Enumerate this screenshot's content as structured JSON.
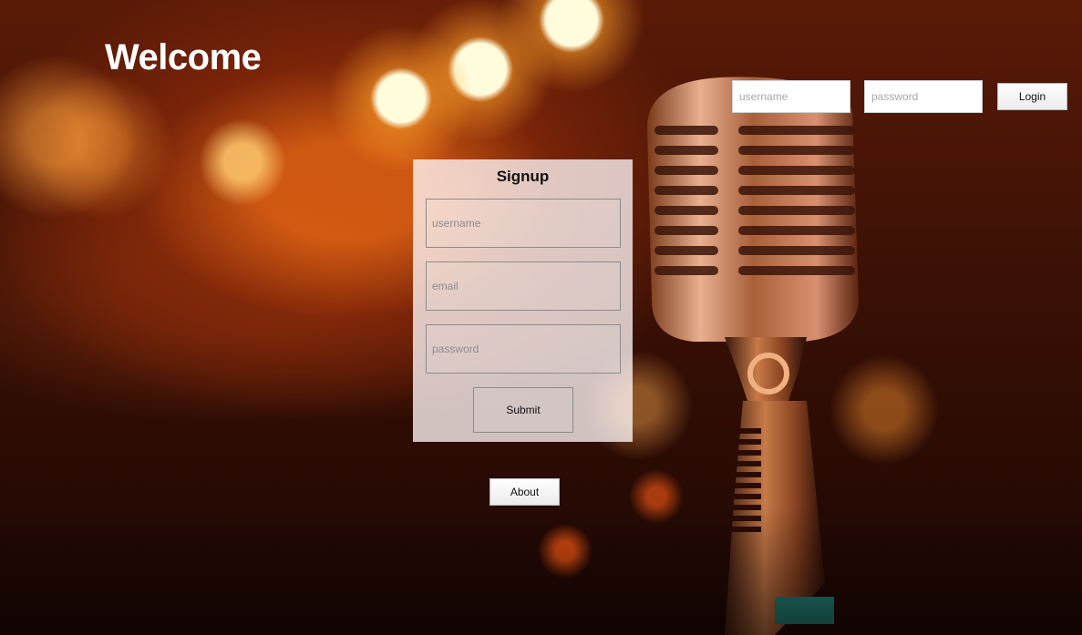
{
  "page": {
    "heading": "Welcome"
  },
  "login": {
    "username_placeholder": "username",
    "password_placeholder": "password",
    "button_label": "Login"
  },
  "signup": {
    "title": "Signup",
    "username_placeholder": "username",
    "email_placeholder": "email",
    "password_placeholder": "password",
    "submit_label": "Submit"
  },
  "footer": {
    "about_label": "About"
  },
  "background": {
    "subject": "vintage microphone with orange bokeh lights"
  },
  "colors": {
    "heading": "#ffffff",
    "signup_panel": "#fff6f6",
    "background_accent": "#e0641a"
  }
}
